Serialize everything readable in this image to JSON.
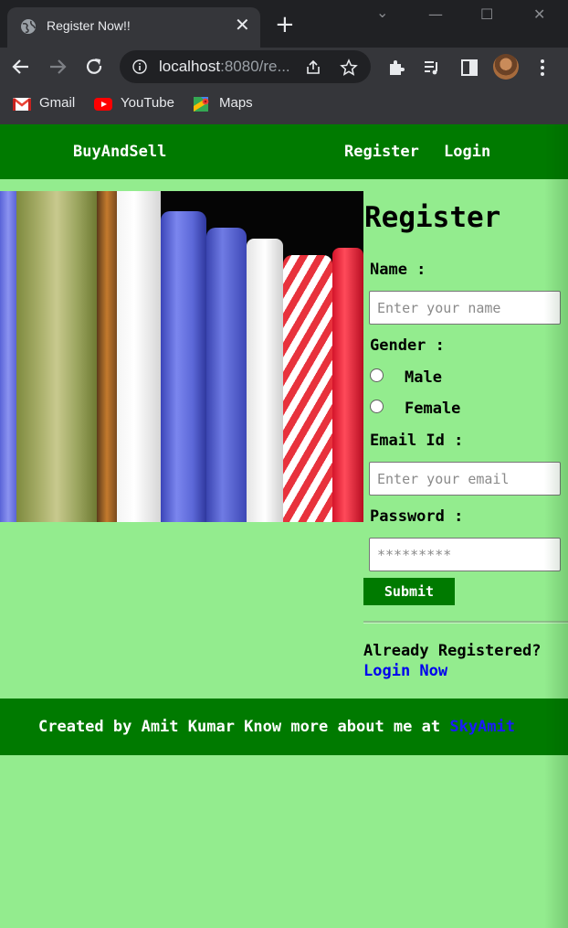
{
  "browser": {
    "tab_title": "Register Now!!",
    "url_host": "localhost",
    "url_rest": ":8080/re...",
    "bookmarks": [
      {
        "label": "Gmail",
        "icon": "gmail-icon"
      },
      {
        "label": "YouTube",
        "icon": "youtube-icon"
      },
      {
        "label": "Maps",
        "icon": "maps-icon"
      }
    ]
  },
  "navbar": {
    "brand": "BuyAndSell",
    "links": [
      "Register",
      "Login"
    ],
    "color": "#007a00"
  },
  "form": {
    "heading": "Register",
    "name_label": "Name :",
    "name_placeholder": "Enter your name",
    "gender_label": "Gender :",
    "gender_options": [
      "Male",
      "Female"
    ],
    "email_label": "Email Id :",
    "email_placeholder": "Enter your email",
    "password_label": "Password :",
    "password_placeholder": "*********",
    "submit_label": "Submit",
    "already_text": "Already Registered?",
    "login_link": "Login Now"
  },
  "footer": {
    "text": "Created by Amit Kumar Know more about me at ",
    "link": "SkyAmit"
  },
  "colors": {
    "page_background": "#93ec8e",
    "accent_green": "#007a00",
    "link_blue": "#0000ee"
  }
}
